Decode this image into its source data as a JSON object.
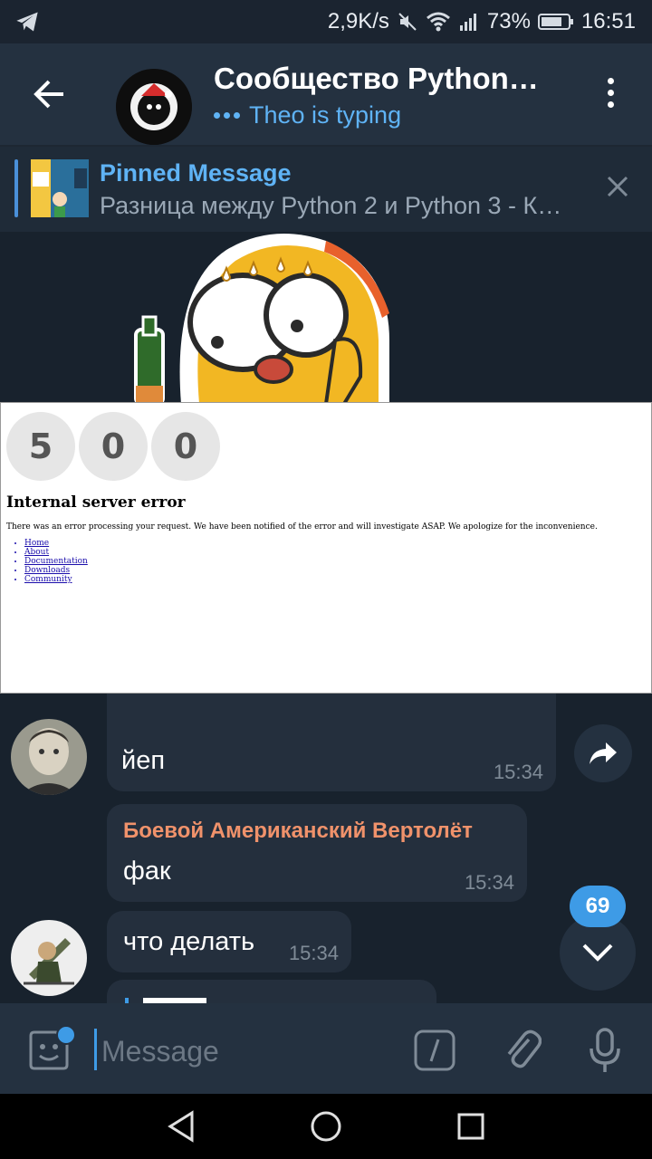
{
  "status_bar": {
    "speed": "2,9K/s",
    "battery": "73%",
    "time": "16:51"
  },
  "header": {
    "title": "Сообщество Python…",
    "status": "Theo is typing"
  },
  "pinned": {
    "title": "Pinned Message",
    "text": "Разница между Python 2 и Python 3 - К…"
  },
  "error_page": {
    "digits": [
      "5",
      "0",
      "0"
    ],
    "title": "Internal server error",
    "text": "There was an error processing your request. We have been notified of the error and will investigate ASAP. We apologize for the inconvenience.",
    "links": [
      "Home",
      "About",
      "Documentation",
      "Downloads",
      "Community"
    ]
  },
  "messages": [
    {
      "text": "йеп",
      "time": "15:34"
    },
    {
      "sender": "Боевой Американский Вертолёт",
      "text": "фак",
      "time": "15:34"
    },
    {
      "text": "что делать",
      "time": "15:34"
    }
  ],
  "unread_count": "69",
  "composer": {
    "placeholder": "Message"
  },
  "colors": {
    "accent": "#3e9be6",
    "sender": "#f0926b",
    "bubble": "#242f3d",
    "background": "#18222d"
  }
}
